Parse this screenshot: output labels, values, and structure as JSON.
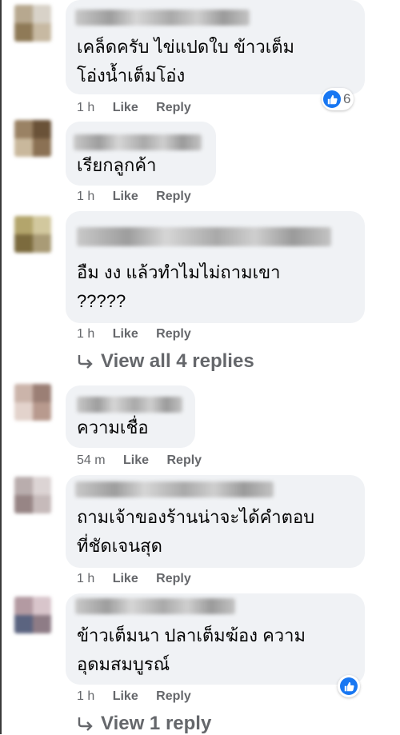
{
  "comments": [
    {
      "lines": [
        "เคล็ดครับ ไข่แปดใบ ข้าวเต็ม",
        "โอ่งน้ำเต็มโอ่ง"
      ],
      "time": "1 h",
      "like": "Like",
      "reply": "Reply",
      "reactions": "6"
    },
    {
      "lines": [
        "เรียกลูกค้า"
      ],
      "time": "1 h",
      "like": "Like",
      "reply": "Reply"
    },
    {
      "lines": [
        "อืม งง แล้วทำไมไม่ถามเขา",
        "?????"
      ],
      "time": "1 h",
      "like": "Like",
      "reply": "Reply"
    },
    {
      "lines": [
        "ความเชื่อ"
      ],
      "time": "54 m",
      "like": "Like",
      "reply": "Reply"
    },
    {
      "lines": [
        "ถามเจ้าของร้านน่าจะได้คำตอบ",
        "ที่ชัดเจนสุด"
      ],
      "time": "1 h",
      "like": "Like",
      "reply": "Reply"
    },
    {
      "lines": [
        "ข้าวเต็มนา ปลาเต็มฆ้อง ความ",
        "อุดมสมบูรณ์"
      ],
      "time": "1 h",
      "like": "Like",
      "reply": "Reply"
    }
  ],
  "view_replies": [
    "View all 4 replies",
    "View 1 reply"
  ],
  "icons": {
    "reply_arrow": "reply-arrow-icon",
    "like": "thumbs-up-icon"
  },
  "colors": {
    "bubble": "#f0f2f5",
    "meta": "#65676b",
    "like_blue": "#1877f2"
  }
}
